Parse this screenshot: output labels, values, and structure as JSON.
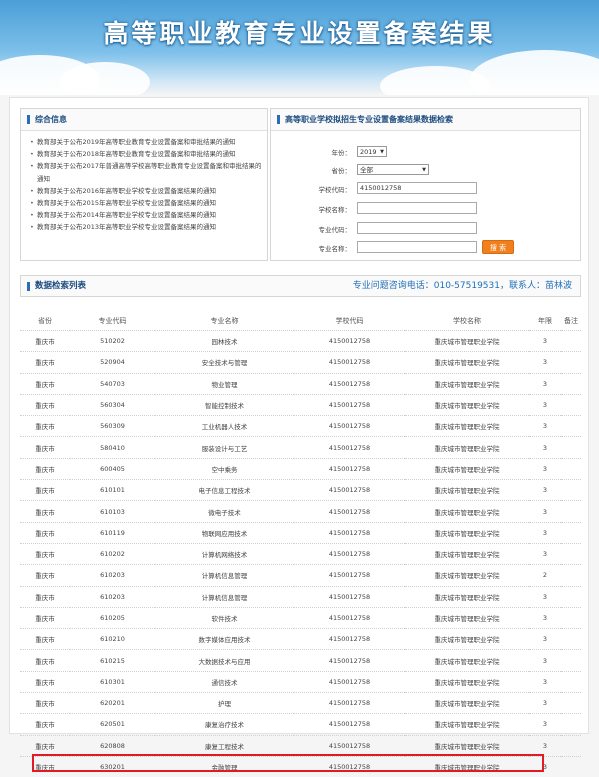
{
  "page": {
    "title": "高等职业教育专业设置备案结果"
  },
  "news_panel": {
    "title": "综合信息",
    "items": [
      "教育部关于公布2019年高等职业教育专业设置备案和审批结果的通知",
      "教育部关于公布2018年高等职业教育专业设置备案和审批结果的通知",
      "教育部关于公布2017年普通高等学校高等职业教育专业设置备案和审批结果的通知",
      "教育部关于公布2016年高等职业学校专业设置备案结果的通知",
      "教育部关于公布2015年高等职业学校专业设置备案结果的通知",
      "教育部关于公布2014年高等职业学校专业设置备案结果的通知",
      "教育部关于公布2013年高等职业学校专业设置备案结果的通知"
    ]
  },
  "search_panel": {
    "title": "高等职业学校拟招生专业设置备案结果数据检索",
    "year_label": "年份：",
    "year_value": "2019",
    "province_label": "省份：",
    "province_value": "全部",
    "school_code_label": "学校代码：",
    "school_code_value": "4150012758",
    "school_name_label": "学校名称：",
    "school_name_value": "",
    "major_code_label": "专业代码：",
    "major_code_value": "",
    "major_name_label": "专业名称：",
    "major_name_value": "",
    "search_button": "搜 索"
  },
  "results": {
    "title": "数据检索列表",
    "hotline": "专业问题咨询电话：010-57519531，联系人：苗林波",
    "columns": [
      "省份",
      "专业代码",
      "专业名称",
      "学校代码",
      "学校名称",
      "年限",
      "备注"
    ],
    "rows": [
      [
        "重庆市",
        "510202",
        "园林技术",
        "4150012758",
        "重庆城市管理职业学院",
        "3",
        ""
      ],
      [
        "重庆市",
        "520904",
        "安全技术与管理",
        "4150012758",
        "重庆城市管理职业学院",
        "3",
        ""
      ],
      [
        "重庆市",
        "540703",
        "物业管理",
        "4150012758",
        "重庆城市管理职业学院",
        "3",
        ""
      ],
      [
        "重庆市",
        "560304",
        "智能控制技术",
        "4150012758",
        "重庆城市管理职业学院",
        "3",
        ""
      ],
      [
        "重庆市",
        "560309",
        "工业机器人技术",
        "4150012758",
        "重庆城市管理职业学院",
        "3",
        ""
      ],
      [
        "重庆市",
        "580410",
        "服装设计与工艺",
        "4150012758",
        "重庆城市管理职业学院",
        "3",
        ""
      ],
      [
        "重庆市",
        "600405",
        "空中乘务",
        "4150012758",
        "重庆城市管理职业学院",
        "3",
        ""
      ],
      [
        "重庆市",
        "610101",
        "电子信息工程技术",
        "4150012758",
        "重庆城市管理职业学院",
        "3",
        ""
      ],
      [
        "重庆市",
        "610103",
        "微电子技术",
        "4150012758",
        "重庆城市管理职业学院",
        "3",
        ""
      ],
      [
        "重庆市",
        "610119",
        "物联网应用技术",
        "4150012758",
        "重庆城市管理职业学院",
        "3",
        ""
      ],
      [
        "重庆市",
        "610202",
        "计算机网络技术",
        "4150012758",
        "重庆城市管理职业学院",
        "3",
        ""
      ],
      [
        "重庆市",
        "610203",
        "计算机信息管理",
        "4150012758",
        "重庆城市管理职业学院",
        "2",
        ""
      ],
      [
        "重庆市",
        "610203",
        "计算机信息管理",
        "4150012758",
        "重庆城市管理职业学院",
        "3",
        ""
      ],
      [
        "重庆市",
        "610205",
        "软件技术",
        "4150012758",
        "重庆城市管理职业学院",
        "3",
        ""
      ],
      [
        "重庆市",
        "610210",
        "数字媒体应用技术",
        "4150012758",
        "重庆城市管理职业学院",
        "3",
        ""
      ],
      [
        "重庆市",
        "610215",
        "大数据技术与应用",
        "4150012758",
        "重庆城市管理职业学院",
        "3",
        ""
      ],
      [
        "重庆市",
        "610301",
        "通信技术",
        "4150012758",
        "重庆城市管理职业学院",
        "3",
        ""
      ],
      [
        "重庆市",
        "620201",
        "护理",
        "4150012758",
        "重庆城市管理职业学院",
        "3",
        ""
      ],
      [
        "重庆市",
        "620501",
        "康复治疗技术",
        "4150012758",
        "重庆城市管理职业学院",
        "3",
        ""
      ],
      [
        "重庆市",
        "620808",
        "康复工程技术",
        "4150012758",
        "重庆城市管理职业学院",
        "3",
        ""
      ],
      [
        "重庆市",
        "630201",
        "金融管理",
        "4150012758",
        "重庆城市管理职业学院",
        "3",
        ""
      ]
    ]
  },
  "colors": {
    "accent": "#1d4c80",
    "highlight": "#e01b24",
    "button": "#f0801e"
  }
}
